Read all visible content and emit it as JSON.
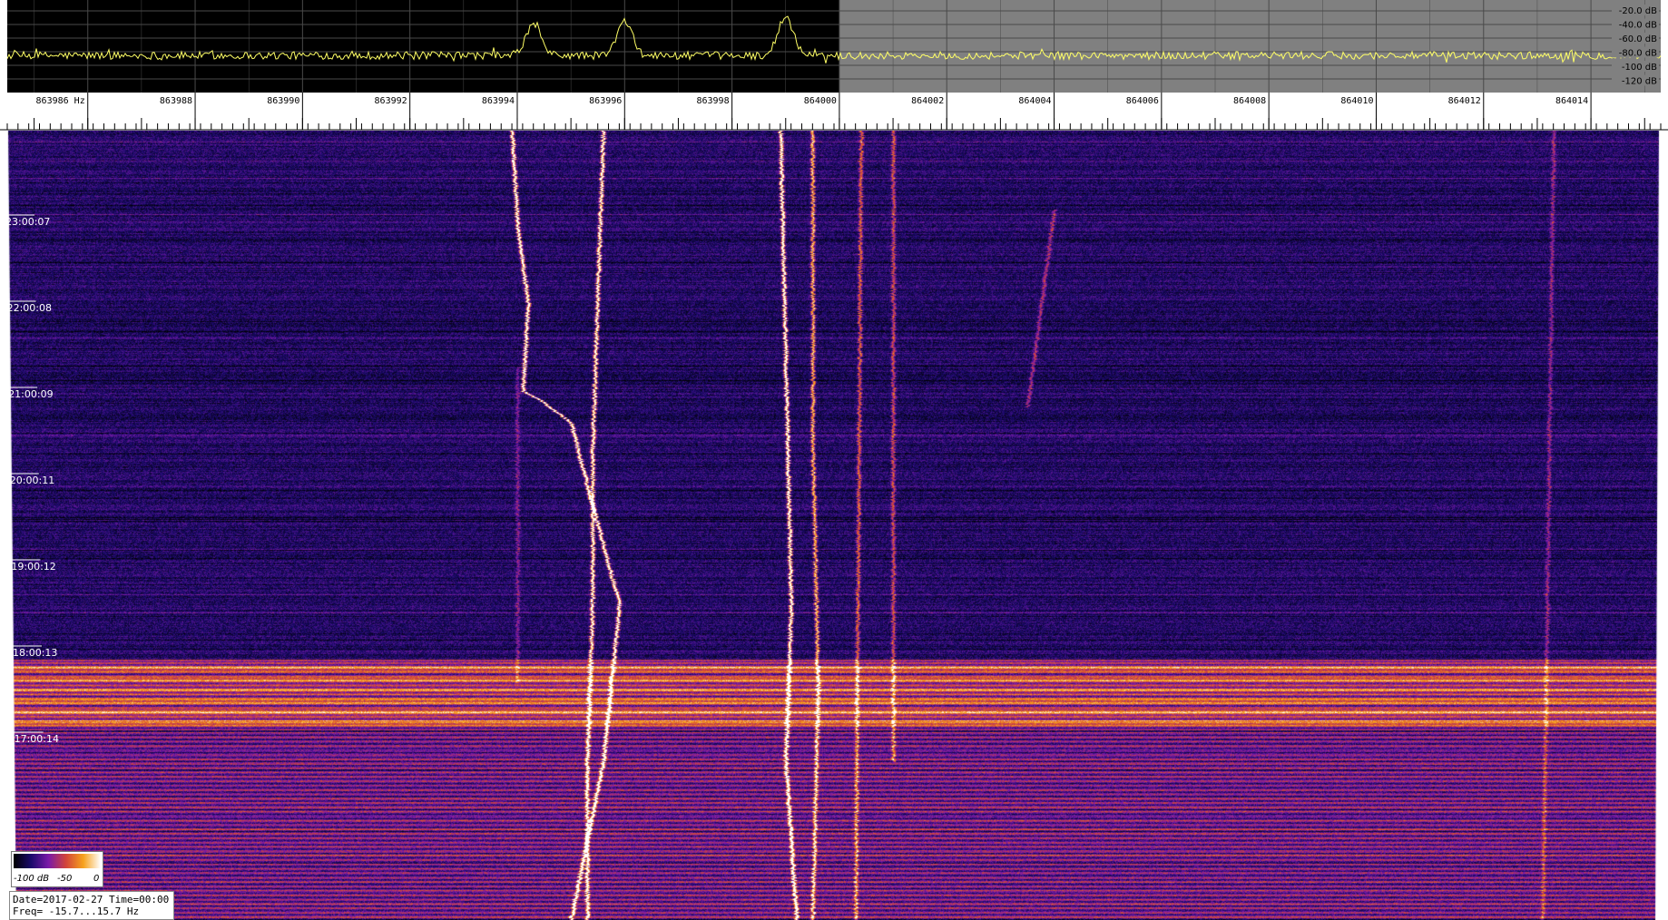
{
  "chart_data": {
    "type": "heatmap",
    "title": "",
    "freq_axis": {
      "unit": "Hz",
      "ticks": [
        "863986",
        "863988",
        "863990",
        "863992",
        "863994",
        "863996",
        "863998",
        "864000",
        "864002",
        "864004",
        "864006",
        "864008",
        "864010",
        "864012",
        "864014"
      ],
      "first_tick_label": "863986 Hz",
      "range": [
        863984.5,
        864015.3
      ]
    },
    "db_axis": {
      "ticks": [
        "-20.0 dB",
        "-40.0 dB",
        "-60.0 dB",
        "-80.0 dB",
        "-100 dB",
        "-120 dB"
      ],
      "range": [
        -130,
        -10
      ]
    },
    "time_axis": {
      "labels": [
        "23:00:07",
        "22:00:08",
        "21:00:09",
        "20:00:11",
        "19:00:12",
        "18:00:13",
        "17:00:14"
      ],
      "direction": "newest-top"
    },
    "colormap": {
      "name": "inferno-like",
      "stops": [
        "#000000",
        "#1a0a6b",
        "#7a1aa8",
        "#d2443a",
        "#f7a21c",
        "#ffffff"
      ],
      "range_db": [
        -100,
        0
      ],
      "labels": [
        "-100 dB",
        "-50",
        "0"
      ]
    },
    "spectrum_peaks": [
      {
        "freq": 863994.3,
        "db": -42
      },
      {
        "freq": 863996.0,
        "db": -38
      },
      {
        "freq": 863999.0,
        "db": -32
      }
    ],
    "noise_floor_db": -82,
    "traces": [
      {
        "name": "",
        "intensity": 1.0,
        "points": [
          [
            863993.9,
            0.0
          ],
          [
            863994.0,
            0.12
          ],
          [
            863994.2,
            0.22
          ],
          [
            863994.1,
            0.33
          ],
          [
            863994.4,
            0.34
          ],
          [
            863995.0,
            0.37
          ],
          [
            863995.3,
            0.45
          ],
          [
            863995.5,
            0.5
          ],
          [
            863995.9,
            0.6
          ],
          [
            863995.6,
            0.8
          ],
          [
            863995.0,
            1.0
          ]
        ]
      },
      {
        "name": "",
        "intensity": 0.95,
        "points": [
          [
            863995.6,
            0.0
          ],
          [
            863995.5,
            0.2
          ],
          [
            863995.4,
            0.4
          ],
          [
            863995.4,
            0.6
          ],
          [
            863995.3,
            0.8
          ],
          [
            863995.3,
            1.0
          ]
        ]
      },
      {
        "name": "",
        "intensity": 1.0,
        "points": [
          [
            863998.9,
            0.0
          ],
          [
            863999.0,
            0.3
          ],
          [
            863999.1,
            0.6
          ],
          [
            863999.0,
            0.8
          ],
          [
            863999.2,
            1.0
          ]
        ]
      },
      {
        "name": "",
        "intensity": 0.7,
        "points": [
          [
            863999.5,
            0.0
          ],
          [
            863999.5,
            0.4
          ],
          [
            863999.6,
            0.7
          ],
          [
            863999.5,
            1.0
          ]
        ]
      },
      {
        "name": "",
        "intensity": 0.5,
        "points": [
          [
            864000.4,
            0.0
          ],
          [
            864000.3,
            1.0
          ]
        ]
      },
      {
        "name": "",
        "intensity": 0.45,
        "points": [
          [
            864001.0,
            0.0
          ],
          [
            864001.0,
            0.8
          ]
        ]
      },
      {
        "name": "",
        "intensity": 0.3,
        "points": [
          [
            864013.3,
            0.0
          ],
          [
            864013.1,
            1.0
          ]
        ]
      },
      {
        "name": "",
        "intensity": 0.25,
        "points": [
          [
            863994.0,
            0.3
          ],
          [
            863994.0,
            0.7
          ]
        ]
      },
      {
        "name": "",
        "intensity": 0.35,
        "points": [
          [
            864004.0,
            0.1
          ],
          [
            864003.5,
            0.35
          ]
        ]
      }
    ],
    "bright_band": {
      "t_start": 0.67,
      "t_end": 0.76,
      "intensity": 0.7
    },
    "selection": {
      "freq_start": 864000.0,
      "shaded": true,
      "shade_color": "#808080"
    },
    "colors": {
      "spectrum_bg": "#000000",
      "spectrum_grid": "#4a4a4a",
      "spectrum_line": "#ffff66",
      "ruler_bg": "#ffffff",
      "tick_text": "#000000"
    }
  },
  "info": {
    "date_line": "Date=2017-02-27 Time=00:00",
    "freq_line": "Freq= -15.7...15.7 Hz"
  }
}
